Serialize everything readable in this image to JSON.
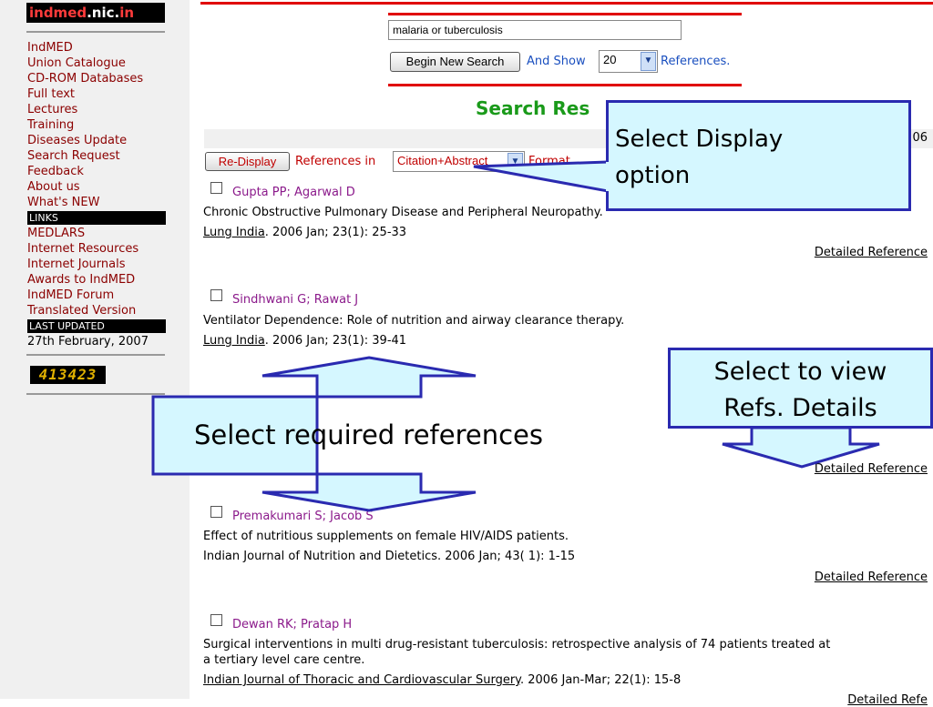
{
  "sidebar": {
    "logo": {
      "part1": "indmed",
      "part2": ".nic.",
      "part3": "in"
    },
    "items": [
      {
        "label": "IndMED",
        "type": "link"
      },
      {
        "label": "Union Catalogue",
        "type": "link"
      },
      {
        "label": "CD-ROM Databases",
        "type": "link"
      },
      {
        "label": "Full text",
        "type": "link"
      },
      {
        "label": "Lectures",
        "type": "link"
      },
      {
        "label": "Training",
        "type": "link"
      },
      {
        "label": "Diseases Update",
        "type": "link"
      },
      {
        "label": "Search Request",
        "type": "link"
      },
      {
        "label": "Feedback",
        "type": "link"
      },
      {
        "label": "About us",
        "type": "link"
      },
      {
        "label": "What's NEW",
        "type": "link"
      },
      {
        "label": "LINKS",
        "type": "header"
      },
      {
        "label": "MEDLARS",
        "type": "link"
      },
      {
        "label": "Internet Resources",
        "type": "link"
      },
      {
        "label": "Internet Journals",
        "type": "link"
      },
      {
        "label": "Awards to IndMED",
        "type": "link"
      },
      {
        "label": "IndMED Forum",
        "type": "link"
      },
      {
        "label": "Translated Version",
        "type": "link"
      },
      {
        "label": "LAST UPDATED",
        "type": "header"
      },
      {
        "label": "27th February, 2007",
        "type": "plain"
      }
    ],
    "counter": "413423"
  },
  "search": {
    "query": "malaria or tuberculosis",
    "begin_label": "Begin New Search",
    "and_show": "And Show",
    "show_value": "20",
    "references_label": "References."
  },
  "results": {
    "title_visible": "Search Res",
    "year_fragment": "06",
    "redisplay_label": "Re-Display",
    "refs_in": "References in",
    "format_value": "Citation+Abstract",
    "format_label": "Format",
    "detail_label": "Detailed Reference",
    "records": [
      {
        "authors": "Gupta PP; Agarwal D",
        "title": "Chronic Obstructive Pulmonary Disease and Peripheral Neuropathy.",
        "journal": "Lung India",
        "citation": ". 2006 Jan; 23(1): 25-33"
      },
      {
        "authors": "Sindhwani G; Rawat J",
        "title": "Ventilator Dependence: Role of nutrition and airway clearance therapy.",
        "journal": "Lung India",
        "citation": ". 2006 Jan; 23(1): 39-41"
      },
      {
        "authors": "Premakumari S; Jacob S",
        "title": "Effect of nutritious supplements on female HIV/AIDS patients.",
        "journal": "Indian Journal of Nutrition and Dietetics. 2006 Jan; 43( 1): 1-15",
        "citation": ""
      },
      {
        "authors": "Dewan RK; Pratap H",
        "title": "Surgical interventions in multi drug-resistant tuberculosis: retrospective analysis of 74 patients treated at",
        "title2": "a tertiary level care centre.",
        "journal": "Indian Journal of Thoracic and Cardiovascular Surgery",
        "citation": ". 2006 Jan-Mar; 22(1): 15-8"
      }
    ],
    "detail_partial": "Detailed Refe"
  },
  "callouts": {
    "display": "Select Display option",
    "details_line1": "Select to view",
    "details_line2": "Refs. Details",
    "required": "Select required references"
  },
  "colors": {
    "accent_red": "#e00000",
    "link_blue": "#1a4fbf",
    "title_green": "#1a9a1a",
    "author_purple": "#8b1a8b",
    "callout_fill": "#d5f7ff",
    "callout_border": "#2a2ab0"
  }
}
